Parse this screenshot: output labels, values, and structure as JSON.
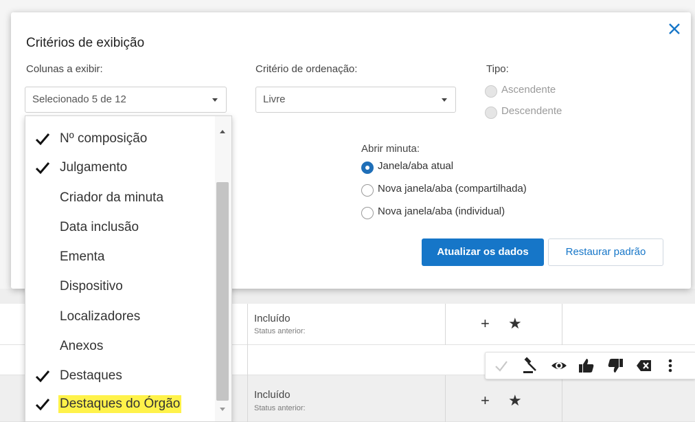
{
  "modal": {
    "title": "Critérios de exibição",
    "close_icon": "close-icon",
    "columns": {
      "label": "Colunas a exibir:",
      "selected_text": "Selecionado 5 de 12"
    },
    "sort": {
      "label": "Critério de ordenação:",
      "selected": "Livre"
    },
    "type": {
      "label": "Tipo:",
      "options": [
        {
          "label": "Ascendente",
          "checked": false,
          "disabled": true
        },
        {
          "label": "Descendente",
          "checked": false,
          "disabled": true
        }
      ]
    },
    "open_minute": {
      "label": "Abrir minuta:",
      "options": [
        {
          "label": "Janela/aba atual",
          "checked": true
        },
        {
          "label": "Nova janela/aba (compartilhada)",
          "checked": false
        },
        {
          "label": "Nova janela/aba (individual)",
          "checked": false
        }
      ]
    },
    "buttons": {
      "update": "Atualizar os dados",
      "restore": "Restaurar padrão"
    }
  },
  "columns_dropdown": {
    "options": [
      {
        "label": "Nº composição",
        "checked": true
      },
      {
        "label": "Julgamento",
        "checked": true
      },
      {
        "label": "Criador da minuta",
        "checked": false
      },
      {
        "label": "Data inclusão",
        "checked": false
      },
      {
        "label": "Ementa",
        "checked": false
      },
      {
        "label": "Dispositivo",
        "checked": false
      },
      {
        "label": "Localizadores",
        "checked": false
      },
      {
        "label": "Anexos",
        "checked": false
      },
      {
        "label": "Destaques",
        "checked": true
      },
      {
        "label": "Destaques do Órgão",
        "checked": true,
        "highlighted": true
      }
    ],
    "highlight_color": "#fff24a"
  },
  "table": {
    "rows": [
      {
        "status": "Incluído",
        "status_sub": "Status anterior:"
      },
      {
        "status": "Incluído",
        "status_sub": "Status anterior:"
      }
    ],
    "row_icons": [
      "plus-icon",
      "star-icon"
    ],
    "plus_glyph": "+",
    "star_glyph": "★",
    "action_icons": [
      "check-icon",
      "gavel-icon",
      "eye-icon",
      "thumbs-up-icon",
      "thumbs-down-icon",
      "delete-icon",
      "more-vertical-icon"
    ]
  },
  "colors": {
    "primary": "#1676c8",
    "radio_selected": "#1f6fb8",
    "close": "#1676c8"
  }
}
